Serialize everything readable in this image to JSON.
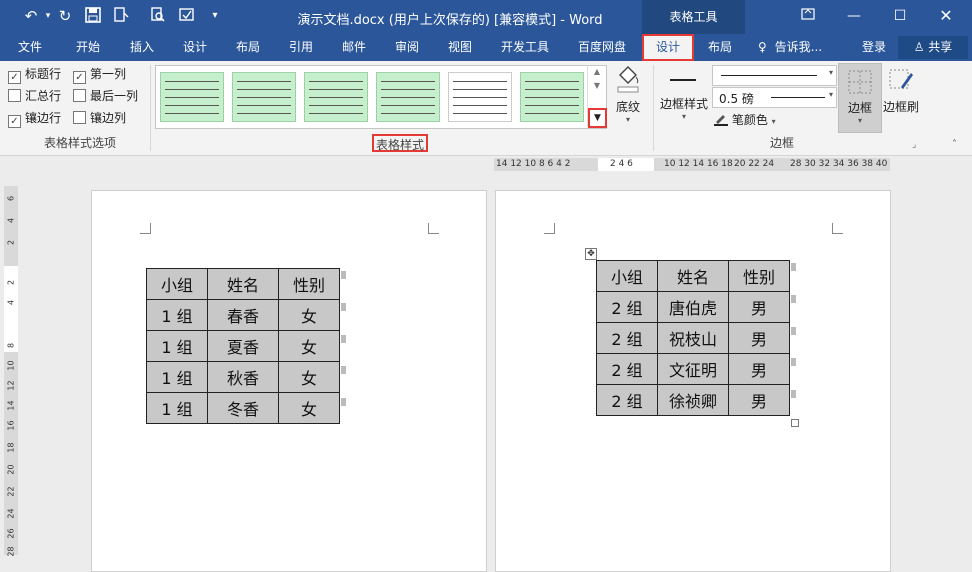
{
  "title_bar": {
    "doc_title": "演示文档.docx (用户上次保存的) [兼容模式] - Word",
    "context_tab_group": "表格工具",
    "icons": [
      "undo-icon",
      "redo-icon",
      "save-icon",
      "print-preview-icon",
      "find-icon",
      "spelling-icon",
      "customize-qat-icon"
    ]
  },
  "tabs": [
    "文件",
    "开始",
    "插入",
    "设计",
    "布局",
    "引用",
    "邮件",
    "审阅",
    "视图",
    "开发工具",
    "百度网盘",
    "设计",
    "布局"
  ],
  "tell_me": "告诉我...",
  "account": {
    "login": "登录",
    "share": "共享"
  },
  "table_style_options": {
    "options": [
      {
        "label": "标题行",
        "checked": true
      },
      {
        "label": "第一列",
        "checked": true
      },
      {
        "label": "汇总行",
        "checked": false
      },
      {
        "label": "最后一列",
        "checked": false
      },
      {
        "label": "镶边行",
        "checked": true
      },
      {
        "label": "镶边列",
        "checked": false
      }
    ],
    "group_label": "表格样式选项"
  },
  "table_styles": {
    "group_label": "表格样式",
    "shading_label": "底纹"
  },
  "borders": {
    "border_styles_label": "边框样式",
    "weight": "0.5 磅",
    "pen_color_label": "笔颜色",
    "borders_button": "边框",
    "painter_button": "边框刷",
    "group_label": "边框"
  },
  "ruler": {
    "h_left": "14 12 10 8 6 4 2",
    "h_mid": "2 4 6",
    "h_right": "10 12 14 16 18",
    "h_right2": "20 22 24",
    "h_right3": "28 30 32 34 36 38 40",
    "v_marks": [
      "6",
      "4",
      "2",
      "2",
      "4",
      "8",
      "10",
      "12",
      "14",
      "16",
      "18",
      "20",
      "22",
      "24",
      "26",
      "28"
    ]
  },
  "page_left_table": {
    "header": [
      "小组",
      "姓名",
      "性别"
    ],
    "rows": [
      [
        "1 组",
        "春香",
        "女"
      ],
      [
        "1 组",
        "夏香",
        "女"
      ],
      [
        "1 组",
        "秋香",
        "女"
      ],
      [
        "1 组",
        "冬香",
        "女"
      ]
    ]
  },
  "page_right_table": {
    "header": [
      "小组",
      "姓名",
      "性别"
    ],
    "rows": [
      [
        "2 组",
        "唐伯虎",
        "男"
      ],
      [
        "2 组",
        "祝枝山",
        "男"
      ],
      [
        "2 组",
        "文征明",
        "男"
      ],
      [
        "2 组",
        "徐祯卿",
        "男"
      ]
    ]
  }
}
